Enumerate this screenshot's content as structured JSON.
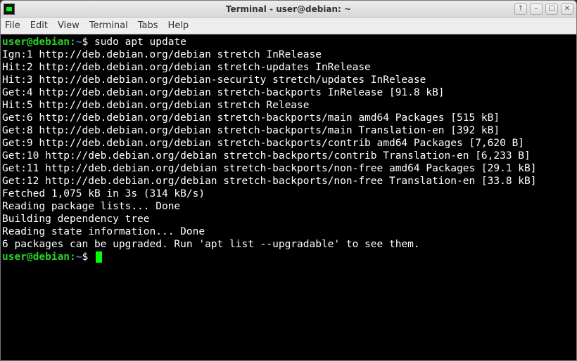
{
  "window": {
    "title": "Terminal - user@debian: ~"
  },
  "titlebar_buttons": {
    "up": "↑",
    "min": "–",
    "max": "☐",
    "close": "✕"
  },
  "menubar": [
    "File",
    "Edit",
    "View",
    "Terminal",
    "Tabs",
    "Help"
  ],
  "prompt": {
    "user": "user@debian",
    "path": "~",
    "sep": ":",
    "sigil": "$"
  },
  "command": "sudo apt update",
  "output": [
    "Ign:1 http://deb.debian.org/debian stretch InRelease",
    "Hit:2 http://deb.debian.org/debian stretch-updates InRelease",
    "Hit:3 http://deb.debian.org/debian-security stretch/updates InRelease",
    "Get:4 http://deb.debian.org/debian stretch-backports InRelease [91.8 kB]",
    "Hit:5 http://deb.debian.org/debian stretch Release",
    "Get:6 http://deb.debian.org/debian stretch-backports/main amd64 Packages [515 kB]",
    "Get:8 http://deb.debian.org/debian stretch-backports/main Translation-en [392 kB]",
    "Get:9 http://deb.debian.org/debian stretch-backports/contrib amd64 Packages [7,620 B]",
    "Get:10 http://deb.debian.org/debian stretch-backports/contrib Translation-en [6,233 B]",
    "Get:11 http://deb.debian.org/debian stretch-backports/non-free amd64 Packages [29.1 kB]",
    "Get:12 http://deb.debian.org/debian stretch-backports/non-free Translation-en [33.8 kB]",
    "Fetched 1,075 kB in 3s (314 kB/s)",
    "Reading package lists... Done",
    "Building dependency tree",
    "Reading state information... Done",
    "6 packages can be upgraded. Run 'apt list --upgradable' to see them."
  ]
}
